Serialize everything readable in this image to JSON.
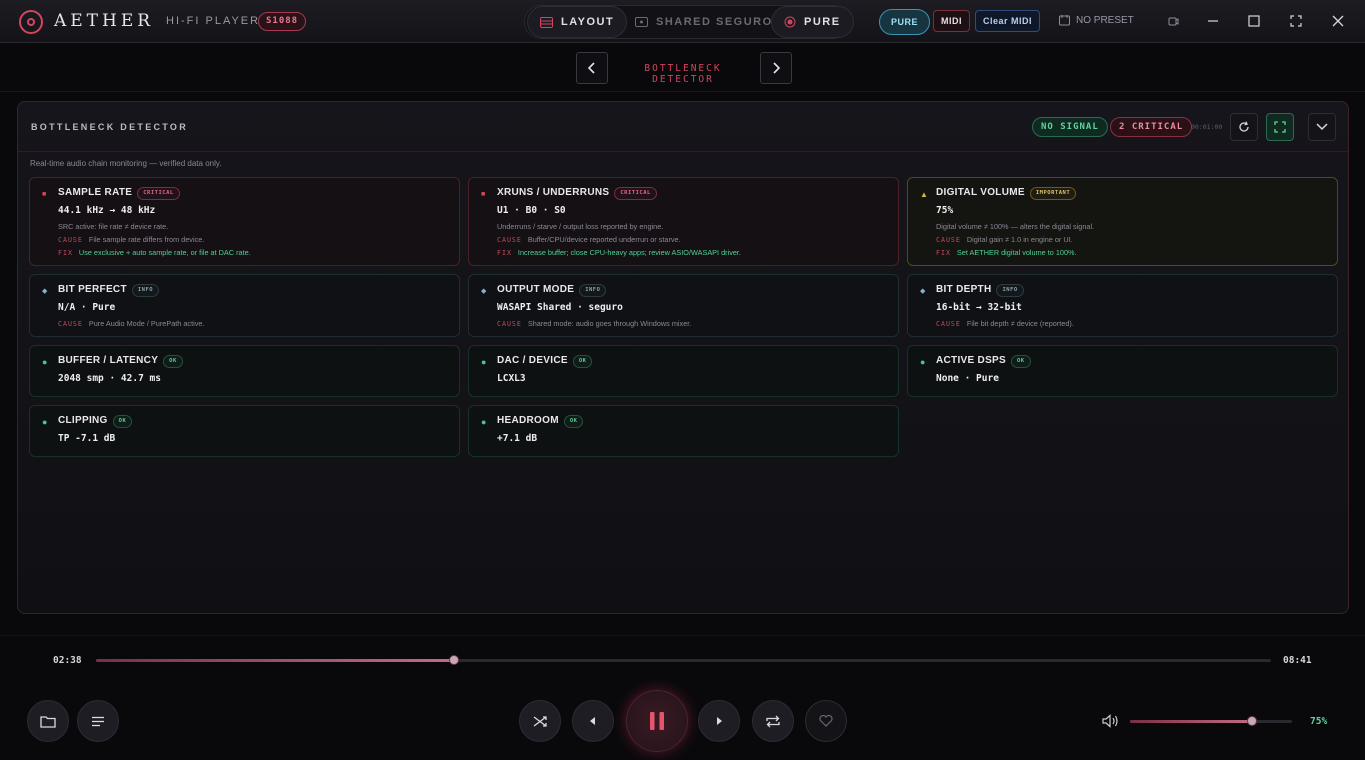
{
  "titlebar": {
    "brand": "AETHER",
    "subtitle": "HI-FI PLAYER",
    "build": "S1088",
    "layout_label": "LAYOUT",
    "shared_label": "SHARED SEGURO",
    "pure_label": "PURE",
    "pure_chip": "PURE",
    "midi_chip": "MIDI",
    "clear_midi": "Clear MIDI",
    "preset": "NO PRESET"
  },
  "nav": {
    "title": "BOTTLENECK DETECTOR"
  },
  "panel": {
    "title": "BOTTLENECK DETECTOR",
    "no_signal": "NO SIGNAL",
    "critical": "2 CRITICAL",
    "timer": "00:01:00",
    "description": "Real-time audio chain monitoring — verified data only."
  },
  "cards": [
    {
      "title": "SAMPLE RATE",
      "tag": "CRITICAL",
      "value": "44.1 kHz → 48 kHz",
      "note": "SRC active: file rate ≠ device rate.",
      "cause_label": "CAUSE",
      "cause": "File sample rate differs from device.",
      "fix_label": "FIX",
      "fix": "Use exclusive + auto sample rate, or file at DAC rate."
    },
    {
      "title": "XRUNS / UNDERRUNS",
      "tag": "CRITICAL",
      "value": "U1 · B0 · S0",
      "note": "Underruns / starve / output loss reported by engine.",
      "cause_label": "CAUSE",
      "cause": "Buffer/CPU/device reported underrun or starve.",
      "fix_label": "FIX",
      "fix": "Increase buffer; close CPU-heavy apps; review ASIO/WASAPI driver."
    },
    {
      "title": "DIGITAL VOLUME",
      "tag": "IMPORTANT",
      "value": "75%",
      "note": "Digital volume ≠ 100% — alters the digital signal.",
      "cause_label": "CAUSE",
      "cause": "Digital gain ≠ 1.0 in engine or UI.",
      "fix_label": "FIX",
      "fix": "Set AETHER digital volume to 100%."
    },
    {
      "title": "BIT PERFECT",
      "tag": "INFO",
      "value": "N/A · Pure",
      "cause_label": "CAUSE",
      "cause": "Pure Audio Mode / PurePath active."
    },
    {
      "title": "OUTPUT MODE",
      "tag": "INFO",
      "value": "WASAPI Shared · seguro",
      "cause_label": "CAUSE",
      "cause": "Shared mode: audio goes through Windows mixer."
    },
    {
      "title": "BIT DEPTH",
      "tag": "INFO",
      "value": "16-bit → 32-bit",
      "cause_label": "CAUSE",
      "cause": "File bit depth ≠ device (reported)."
    },
    {
      "title": "BUFFER / LATENCY",
      "tag": "OK",
      "value": "2048 smp · 42.7 ms"
    },
    {
      "title": "DAC / DEVICE",
      "tag": "OK",
      "value": "LCXL3"
    },
    {
      "title": "ACTIVE DSPS",
      "tag": "OK",
      "value": "None · Pure"
    },
    {
      "title": "CLIPPING",
      "tag": "OK",
      "value": "TP -7.1 dB"
    },
    {
      "title": "HEADROOM",
      "tag": "OK",
      "value": "+7.1 dB"
    }
  ],
  "player": {
    "elapsed": "02:38",
    "total": "08:41",
    "progress": 0.305,
    "volume_pct": "75%",
    "volume": 0.75
  },
  "colors": {
    "accent": "#d0465f",
    "ok": "#5fc79a",
    "warn": "#dcc069",
    "info": "#7fb6c9"
  }
}
